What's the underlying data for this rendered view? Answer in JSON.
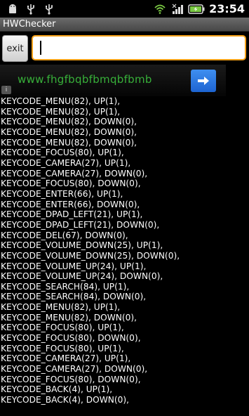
{
  "status_bar": {
    "time": "23:54",
    "left_icons": [
      "android-notification-icon",
      "usb-icon",
      "usb-icon"
    ],
    "right_icons": [
      "wifi-icon",
      "signal-icon",
      "battery-charging-icon"
    ]
  },
  "app": {
    "title": "HWChecker"
  },
  "controls": {
    "exit_label": "exit",
    "input_value": ""
  },
  "ad": {
    "text": "www.fhgfbqbfbmqbfbmb"
  },
  "log_lines": [
    "KEYCODE_MENU(82), UP(1),",
    "KEYCODE_MENU(82), UP(1),",
    "KEYCODE_MENU(82), DOWN(0),",
    "KEYCODE_MENU(82), DOWN(0),",
    "KEYCODE_MENU(82), DOWN(0),",
    "KEYCODE_FOCUS(80), UP(1),",
    "KEYCODE_CAMERA(27), UP(1),",
    "KEYCODE_CAMERA(27), DOWN(0),",
    "KEYCODE_FOCUS(80), DOWN(0),",
    "KEYCODE_ENTER(66), UP(1),",
    "KEYCODE_ENTER(66), DOWN(0),",
    "KEYCODE_DPAD_LEFT(21), UP(1),",
    "KEYCODE_DPAD_LEFT(21), DOWN(0),",
    "KEYCODE_DEL(67), DOWN(0),",
    "KEYCODE_VOLUME_DOWN(25), UP(1),",
    "KEYCODE_VOLUME_DOWN(25), DOWN(0),",
    "KEYCODE_VOLUME_UP(24), UP(1),",
    "KEYCODE_VOLUME_UP(24), DOWN(0),",
    "KEYCODE_SEARCH(84), UP(1),",
    "KEYCODE_SEARCH(84), DOWN(0),",
    "KEYCODE_MENU(82), UP(1),",
    "KEYCODE_MENU(82), DOWN(0),",
    "KEYCODE_FOCUS(80), UP(1),",
    "KEYCODE_FOCUS(80), DOWN(0),",
    "KEYCODE_FOCUS(80), UP(1),",
    "KEYCODE_CAMERA(27), UP(1),",
    "KEYCODE_CAMERA(27), DOWN(0),",
    "KEYCODE_FOCUS(80), DOWN(0),",
    "KEYCODE_BACK(4), UP(1),",
    "KEYCODE_BACK(4), DOWN(0),"
  ]
}
